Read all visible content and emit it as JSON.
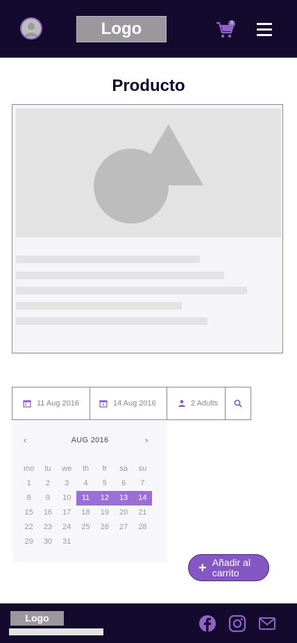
{
  "header": {
    "logo_label": "Logo",
    "cart_count": "3",
    "icons": [
      "user-avatar-icon",
      "cart-icon",
      "hamburger-menu-icon"
    ]
  },
  "page": {
    "title": "Producto"
  },
  "booking": {
    "checkin": "11 Aug 2016",
    "checkout": "14 Aug 2016",
    "guests": "2 Adults",
    "search_icon": "search-icon"
  },
  "calendar": {
    "month": "AUG 2016",
    "prev": "‹",
    "next": "›",
    "weekdays": [
      "mo",
      "tu",
      "we",
      "th",
      "fr",
      "sa",
      "su"
    ],
    "weeks": [
      [
        "1",
        "2",
        "3",
        "4",
        "5",
        "6",
        "7"
      ],
      [
        "8",
        "9",
        "10",
        "11",
        "12",
        "13",
        "14"
      ],
      [
        "15",
        "16",
        "17",
        "18",
        "19",
        "20",
        "21"
      ],
      [
        "22",
        "23",
        "24",
        "25",
        "26",
        "27",
        "28"
      ],
      [
        "29",
        "30",
        "31",
        "",
        "",
        "",
        ""
      ]
    ],
    "selected": [
      "11",
      "12",
      "13",
      "14"
    ]
  },
  "actions": {
    "add_to_cart": "Añadir al carrito"
  },
  "footer": {
    "logo_label": "Logo",
    "icons": [
      "facebook-icon",
      "instagram-icon",
      "mail-icon"
    ]
  },
  "colors": {
    "header_bg": "#130a2e",
    "accent": "#8e63c6",
    "selected_day": "#9b6fd4",
    "button": "#8457c4"
  }
}
